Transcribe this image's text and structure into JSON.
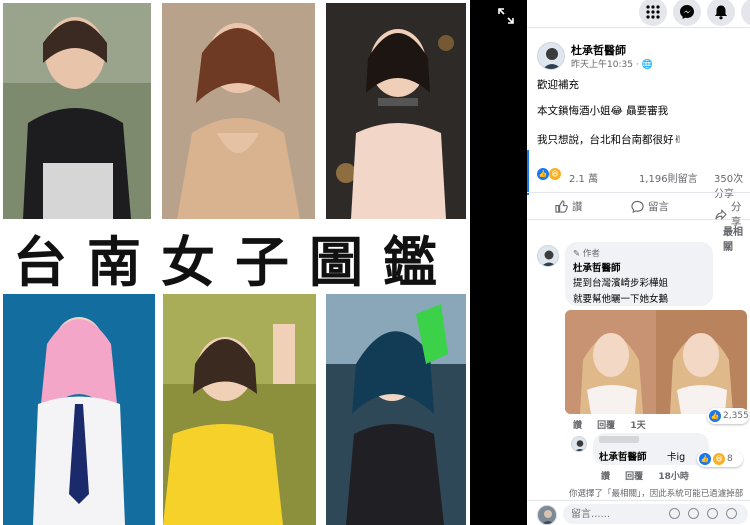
{
  "collage": {
    "title": "台南女子圖鑑"
  },
  "post": {
    "author": "杜承哲醫師",
    "time": "昨天上午10:35 · ",
    "line1": "歡迎補充",
    "line2": "本文鎖悔酒小姐😂 贔要審我",
    "line3": "我只想說，台北和台南都很好✌",
    "likes": "2.1 萬",
    "comments_count": "1,196則留言",
    "shares_count": "350次分享"
  },
  "actions": {
    "like": "讚",
    "comment": "留言",
    "share": "分享",
    "sort": "最相關"
  },
  "comment1": {
    "badge": "作者",
    "name": "杜承哲醫師",
    "text1": "提到台灣濱崎步彩樺姐",
    "text2": "就要幫他曬一下她女鵝",
    "reaction_count": "2,355",
    "like": "讚",
    "reply": "回覆",
    "time": "1天"
  },
  "comment2": {
    "name": "杜承哲醫師",
    "text": "卡ig",
    "reaction_count": "8",
    "like": "讚",
    "reply": "回覆",
    "time": "18小時"
  },
  "notice": "你選擇了「最相關」，因此系統可能已過濾掉部",
  "composer": {
    "placeholder": "留言......"
  },
  "colors": {
    "facebook_blue": "#1877f2",
    "text_secondary": "#65676b"
  }
}
